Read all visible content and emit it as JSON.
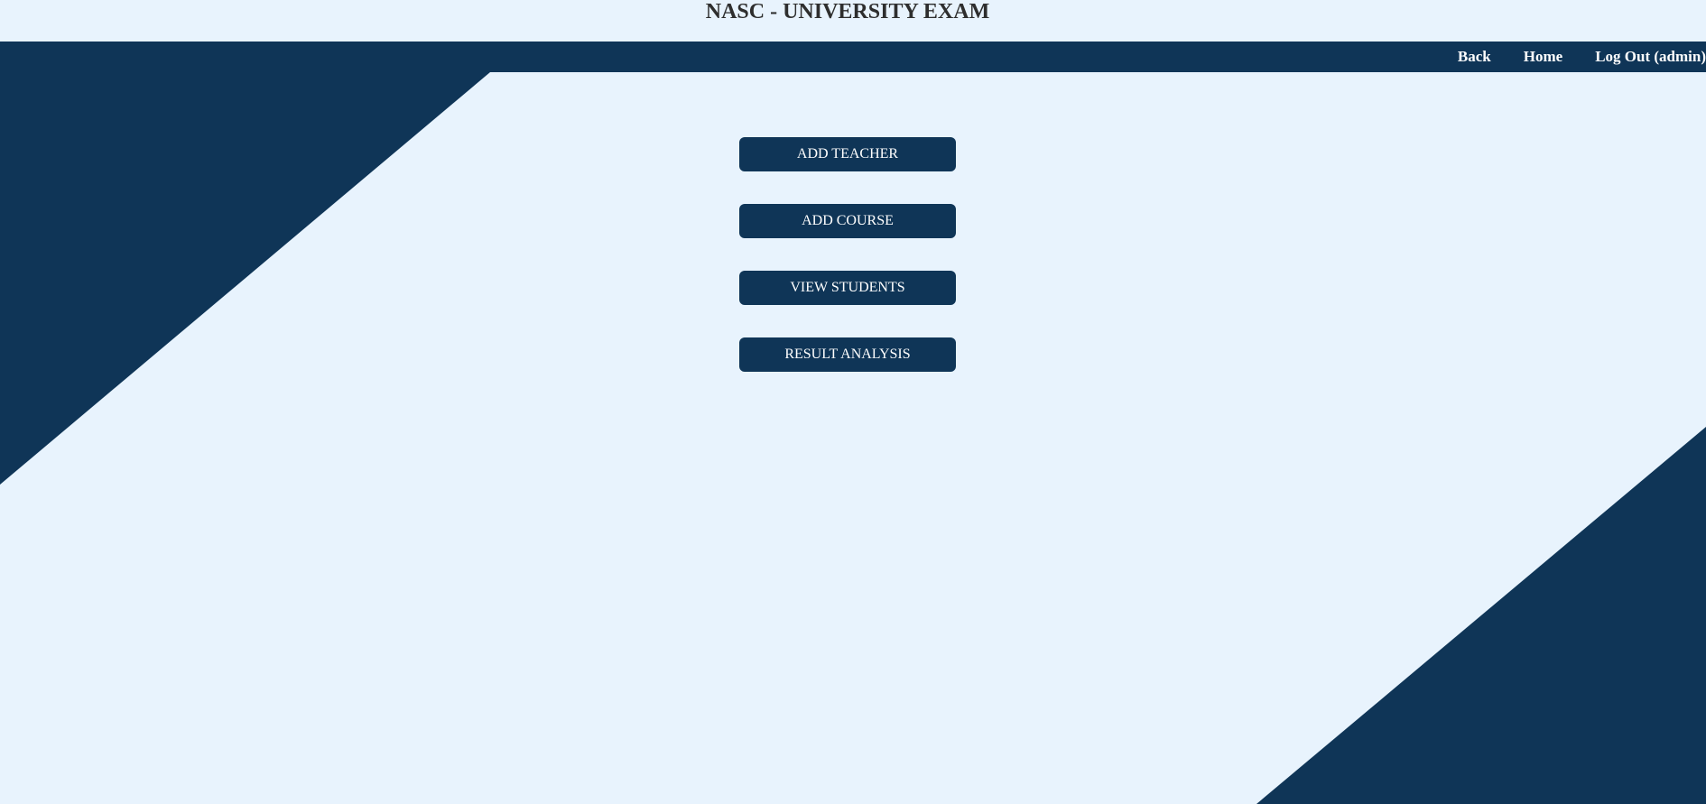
{
  "header": {
    "title": "NASC - UNIVERSITY EXAM"
  },
  "nav": {
    "links": [
      {
        "label": "Back"
      },
      {
        "label": "Home"
      },
      {
        "label": "Log Out (admin)"
      }
    ]
  },
  "menu": {
    "buttons": [
      {
        "label": "ADD TEACHER"
      },
      {
        "label": "ADD COURSE"
      },
      {
        "label": "VIEW STUDENTS"
      },
      {
        "label": "RESULT ANALYSIS"
      }
    ]
  },
  "colors": {
    "background": "#e8f3fd",
    "primary": "#0f3557",
    "button_text": "#ffffff",
    "title_text": "#2e2e2e"
  }
}
